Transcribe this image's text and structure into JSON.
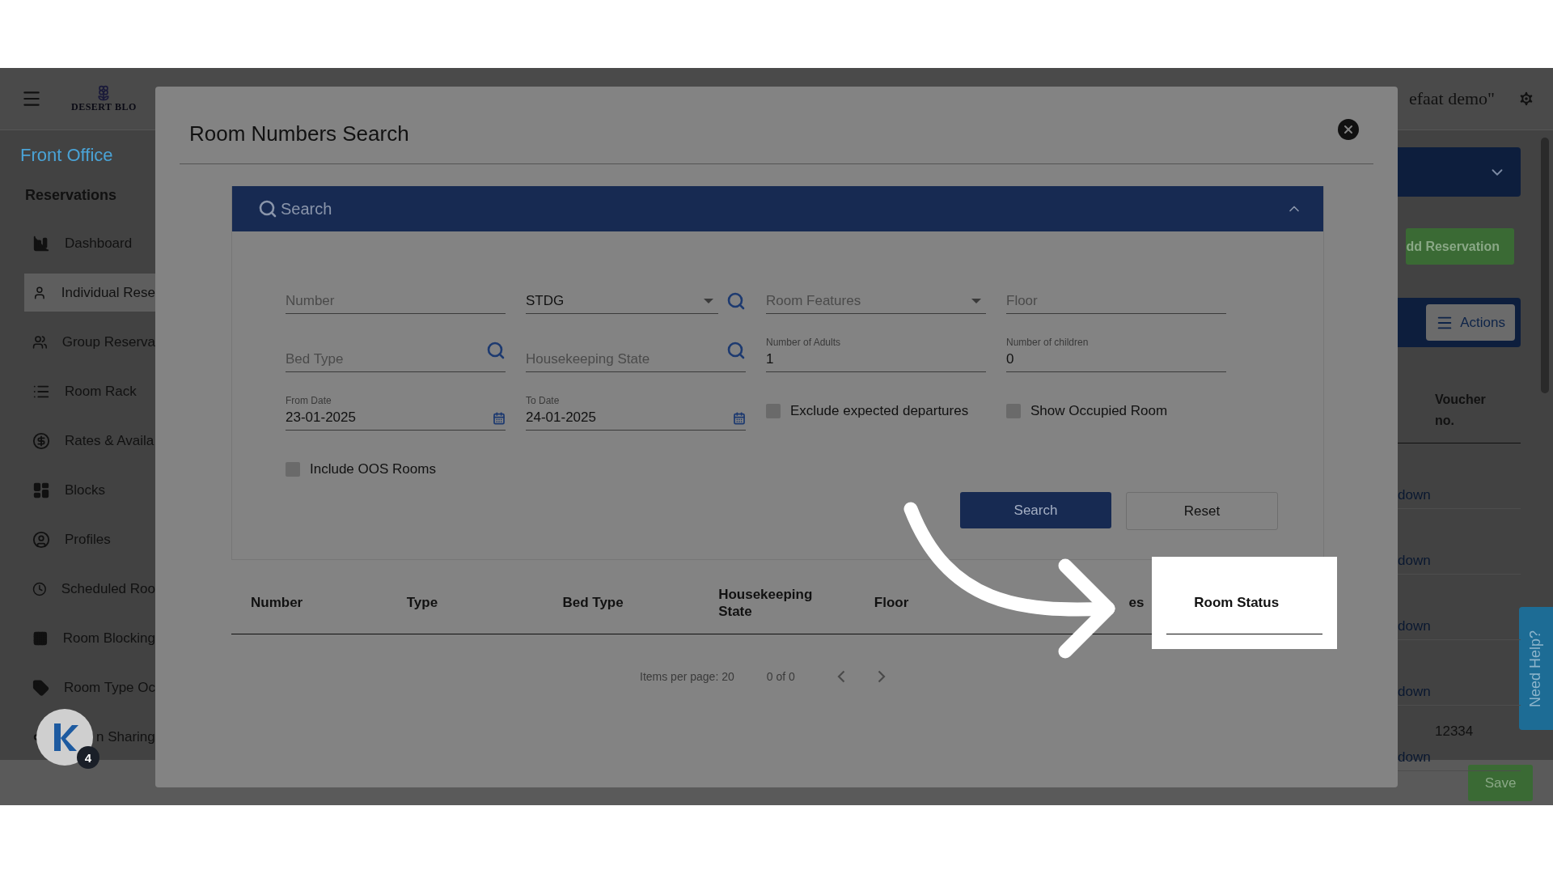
{
  "app_header": {
    "logo_text": "DESERT BLO",
    "user_text": "efaat demo\""
  },
  "sidebar": {
    "module": "Front Office",
    "section": "Reservations",
    "items": [
      {
        "label": "Dashboard",
        "selected": false
      },
      {
        "label": "Individual Rese",
        "selected": true
      },
      {
        "label": "Group Reserva",
        "selected": false
      },
      {
        "label": "Room Rack",
        "selected": false
      },
      {
        "label": "Rates & Availa",
        "selected": false
      },
      {
        "label": "Blocks",
        "selected": false
      },
      {
        "label": "Profiles",
        "selected": false
      },
      {
        "label": "Scheduled Roo",
        "selected": false
      },
      {
        "label": "Room Blocking",
        "selected": false
      },
      {
        "label": "Room Type Oc",
        "selected": false
      },
      {
        "label": "n Sharing",
        "selected": false
      }
    ]
  },
  "background_page": {
    "add_button": "dd Reservation",
    "actions_button": "Actions",
    "voucher_header": "Voucher no.",
    "rows": [
      {
        "status": "down",
        "voucher": ""
      },
      {
        "status": "down",
        "voucher": ""
      },
      {
        "status": "down",
        "voucher": ""
      },
      {
        "status": "down",
        "voucher": ""
      },
      {
        "status": "down",
        "voucher": "12334"
      }
    ],
    "help_tab": "Need Help?",
    "save_button": "Save"
  },
  "dialog": {
    "title": "Room Numbers Search",
    "search_panel": {
      "title": "Search",
      "expanded": true,
      "fields": [
        {
          "kind": "text",
          "placeholder": "Number"
        },
        {
          "kind": "select-lookup",
          "value": "STDG"
        },
        {
          "kind": "select",
          "placeholder": "Room Features"
        },
        {
          "kind": "text",
          "placeholder": "Floor"
        },
        {
          "kind": "lookup",
          "placeholder": "Bed Type"
        },
        {
          "kind": "lookup",
          "placeholder": "Housekeeping State"
        },
        {
          "kind": "number",
          "label": "Number of Adults",
          "value": "1"
        },
        {
          "kind": "number",
          "label": "Number of children",
          "value": "0"
        },
        {
          "kind": "date",
          "label": "From Date",
          "value": "23-01-2025"
        },
        {
          "kind": "date",
          "label": "To Date",
          "value": "24-01-2025"
        },
        {
          "kind": "checkbox",
          "label": "Exclude expected departures",
          "checked": false
        },
        {
          "kind": "checkbox",
          "label": "Show Occupied Room",
          "checked": false
        },
        {
          "kind": "checkbox",
          "label": "Include OOS Rooms",
          "checked": false
        }
      ],
      "buttons": [
        {
          "label": "Search",
          "primary": true
        },
        {
          "label": "Reset",
          "primary": false
        }
      ]
    },
    "table": {
      "columns": [
        {
          "label": "Number",
          "highlighted": false
        },
        {
          "label": "Type",
          "highlighted": false
        },
        {
          "label": "Bed Type",
          "highlighted": false
        },
        {
          "label": "Housekeeping State",
          "highlighted": false
        },
        {
          "label": "Floor",
          "highlighted": false
        },
        {
          "label": "es",
          "highlighted": false
        },
        {
          "label": "Room Status",
          "highlighted": true
        }
      ]
    },
    "pagination": {
      "items_per_page": "Items per page: 20",
      "range": "0 of 0"
    }
  },
  "assistant_badge": {
    "count": "4"
  }
}
